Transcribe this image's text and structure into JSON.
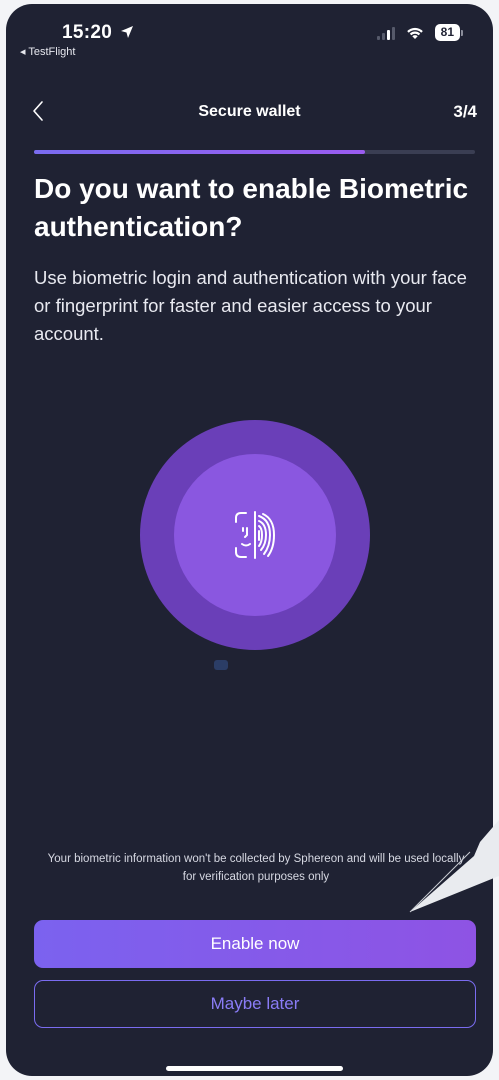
{
  "status_bar": {
    "time": "15:20",
    "back_app": "◂ TestFlight",
    "battery": "81"
  },
  "header": {
    "title": "Secure wallet",
    "step": "3/4"
  },
  "progress": {
    "fraction": 0.75
  },
  "content": {
    "title": "Do you want to enable Biometric authentication?",
    "description": "Use biometric login and authentication with your face or fingerprint for faster and easier access to your account."
  },
  "illustration": {
    "icon": "face-fingerprint-icon"
  },
  "footer": {
    "disclaimer": "Your biometric information won't be collected by Sphereon and will be used locally for verification purposes only",
    "enable_label": "Enable now",
    "later_label": "Maybe later"
  },
  "colors": {
    "background": "#1f2233",
    "accent": "#7a6cf0",
    "circle_outer": "#6a3fb8",
    "circle_inner": "#8a57e0"
  }
}
